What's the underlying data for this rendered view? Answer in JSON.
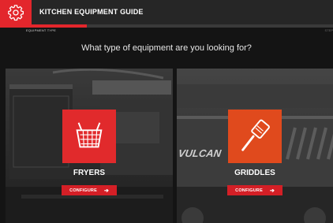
{
  "app": {
    "title": "KITCHEN EQUIPMENT GUIDE",
    "logo_icon": "gear-icon"
  },
  "progress": {
    "fraction": 0.26,
    "first_step_label": "EQUIPMENT TYPE",
    "last_step_label": "STEP"
  },
  "prompt": "What type of equipment are you looking for?",
  "categories": [
    {
      "label": "FRYERS",
      "button_label": "CONFIGURE",
      "icon": "fryer-basket-icon",
      "tile_color": "#e12a2c",
      "background_brand": "VULCAN"
    },
    {
      "label": "GRIDDLES",
      "button_label": "CONFIGURE",
      "icon": "spatula-icon",
      "tile_color": "#e04a1d",
      "background_brand": "VULCAN"
    }
  ],
  "colors": {
    "accent": "#e3262c",
    "topbar": "#262626",
    "background": "#141414"
  }
}
